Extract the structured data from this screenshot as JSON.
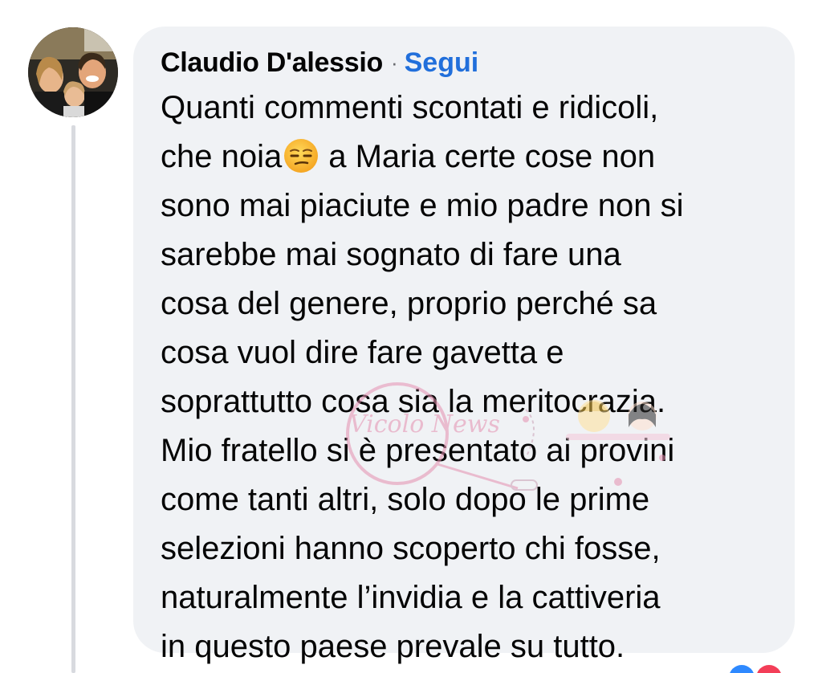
{
  "comment": {
    "author": "Claudio D'alessio",
    "separator": "·",
    "follow_label": "Segui",
    "lines": {
      "l1": "Quanti commenti scontati e ridicoli,",
      "l2_before": "che noia",
      "l2_after": "a Maria certe cose non",
      "l3": "sono mai piaciute e mio padre non si",
      "l4": "sarebbe mai sognato di fare una",
      "l5": "cosa del genere, proprio perché sa",
      "l6": "cosa vuol dire fare gavetta e",
      "l7": "soprattutto cosa sia la meritocrazia.",
      "l8": "Mio fratello si è presentato ai provini",
      "l9": "come tanti altri, solo dopo le prime",
      "l10": "selezioni hanno scoperto chi fosse,",
      "l11": "naturalmente l’invidia e la cattiveria",
      "l12": "in questo paese prevale su tutto."
    },
    "emoji_name": "unamused-face-emoji"
  },
  "watermark": {
    "text": "Vicolo News"
  },
  "colors": {
    "bubble_bg": "#f0f2f5",
    "author_text": "#050505",
    "follow_link": "#216fdb",
    "thread_line": "#d8dadf",
    "watermark_pink": "#e58fb0"
  }
}
